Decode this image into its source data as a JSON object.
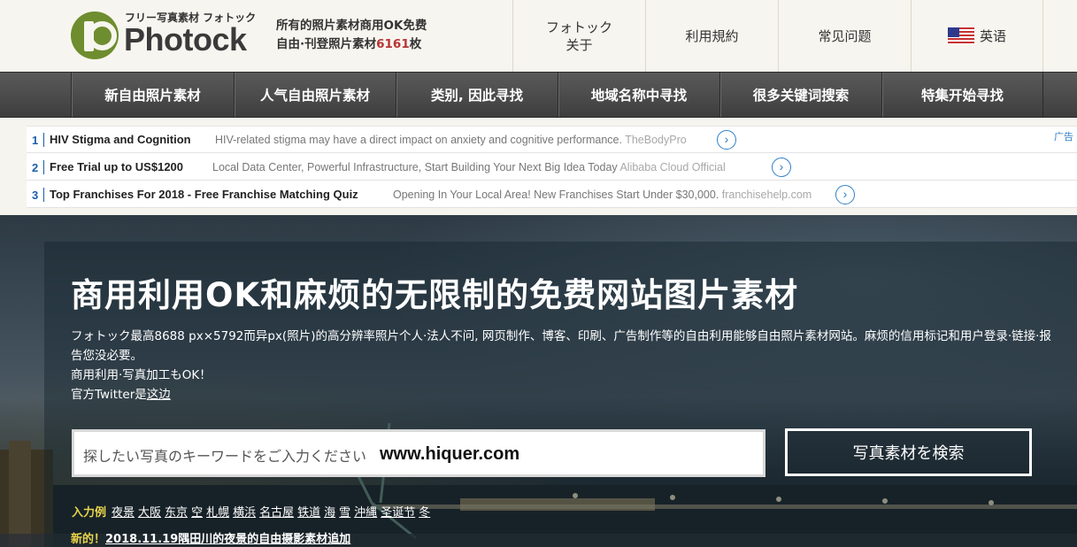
{
  "header": {
    "tagline": "フリー写真素材 フォトック",
    "brand": "Photock",
    "promo_line1": "所有的照片素材商用OK免费",
    "promo_line2_prefix": "自由·刊登照片素材",
    "promo_count": "6161",
    "promo_suffix": "枚",
    "nav": {
      "about_line1": "フォトック",
      "about_line2": "关于",
      "terms": "利用規約",
      "faq": "常见问题",
      "language": "英语"
    }
  },
  "categories": [
    "新自由照片素材",
    "人气自由照片素材",
    "类别, 因此寻找",
    "地域名称中寻找",
    "很多关键词搜索",
    "特集开始寻找"
  ],
  "ads": {
    "label": "广告",
    "items": [
      {
        "num": "1",
        "title": "HIV Stigma and Cognition",
        "text": "HIV-related stigma may have a direct impact on anxiety and cognitive performance.",
        "source": "TheBodyPro"
      },
      {
        "num": "2",
        "title": "Free Trial up to US$1200",
        "text": "Local Data Center, Powerful Infrastructure, Start Building Your Next Big Idea Today",
        "source": "Alibaba Cloud Official"
      },
      {
        "num": "3",
        "title": "Top Franchises For 2018 - Free Franchise Matching Quiz",
        "text": "Opening In Your Local Area! New Franchises Start Under $30,000.",
        "source": "franchisehelp.com"
      }
    ]
  },
  "hero": {
    "title": "商用利用OK和麻烦的无限制的免费网站图片素材",
    "desc_line1": "フォトック最高8688 px×5792而异px(照片)的高分辨率照片个人·法人不问, 网页制作、博客、印刷、广告制作等的自由利用能够自由照片素材网站。麻烦的信用标记和用户登录·链接·报告您没必要。",
    "desc_line2": "商用利用·写真加工もOK！",
    "desc_line3_prefix": "官方Twitter是",
    "desc_line3_link": "这边",
    "search_placeholder": "探したい写真のキーワードをご入力ください",
    "watermark": "www.hiquer.com",
    "search_button": "写真素材を検索",
    "examples_label": "入力例",
    "examples": [
      "夜景",
      "大阪",
      "东京",
      "空",
      "札幌",
      "横浜",
      "名古屋",
      "铁道",
      "海",
      "雪",
      "沖縄",
      "圣诞节",
      "冬"
    ],
    "news_label": "新的！",
    "news_text": "2018.11.19隅田川的夜景的自由摄影素材追加"
  },
  "colors": {
    "brand_green": "#6e8d2f",
    "accent_yellow": "#e8d44a",
    "link_blue": "#2f7fc8",
    "count_red": "#b83535"
  }
}
